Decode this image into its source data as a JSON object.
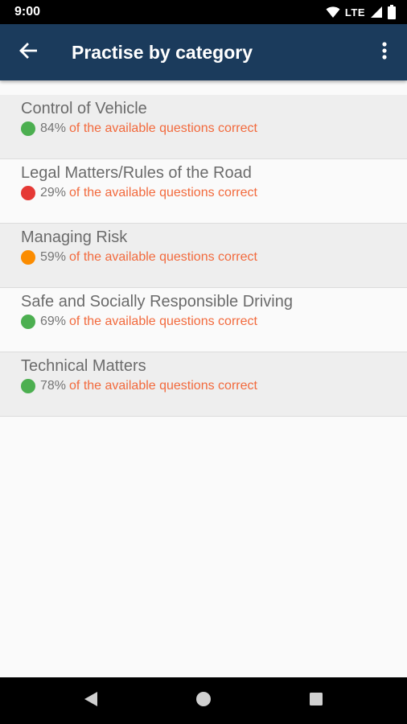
{
  "status_bar": {
    "time": "9:00",
    "network": "LTE"
  },
  "app_bar": {
    "title": "Practise by category"
  },
  "categories": [
    {
      "title": "Control of Vehicle",
      "percent": "84%",
      "suffix": "of the available questions correct",
      "dot_color": "#4caf50"
    },
    {
      "title": "Legal Matters/Rules of the Road",
      "percent": "29%",
      "suffix": "of the available questions correct",
      "dot_color": "#e53935"
    },
    {
      "title": "Managing Risk",
      "percent": "59%",
      "suffix": "of the available questions correct",
      "dot_color": "#fb8c00"
    },
    {
      "title": "Safe and Socially Responsible Driving",
      "percent": "69%",
      "suffix": "of the available questions correct",
      "dot_color": "#4caf50"
    },
    {
      "title": "Technical Matters",
      "percent": "78%",
      "suffix": "of the available questions correct",
      "dot_color": "#4caf50"
    }
  ],
  "colors": {
    "app_bar": "#1b3b5c",
    "accent_text": "#f26a3d"
  }
}
